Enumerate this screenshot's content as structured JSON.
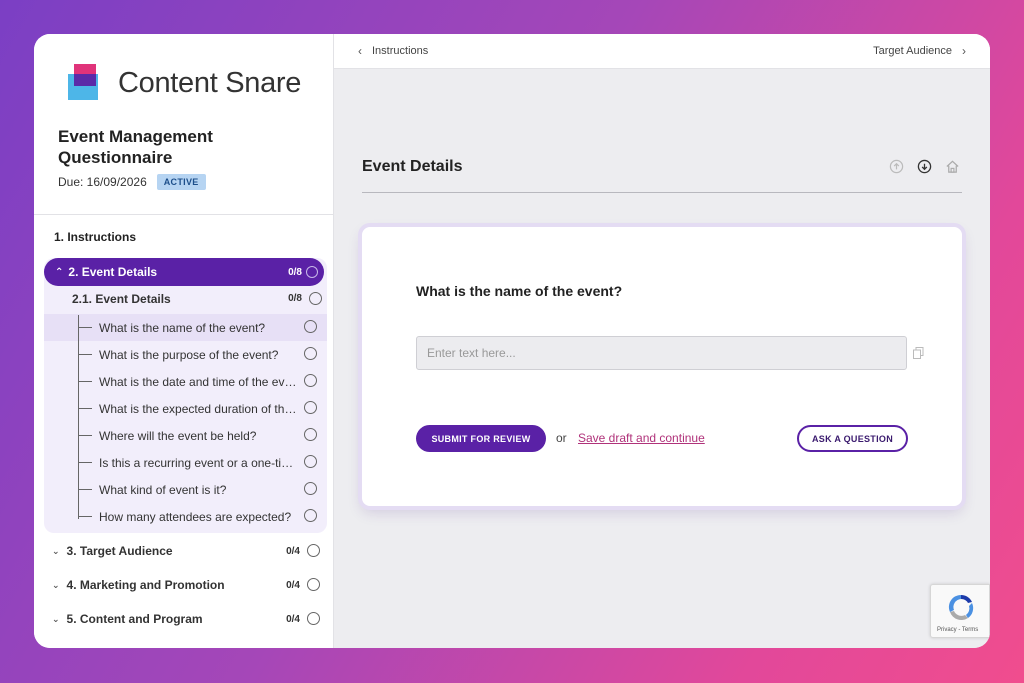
{
  "brand": {
    "name": "Content Snare"
  },
  "questionnaire": {
    "title": "Event Management Questionnaire",
    "due": "Due: 16/09/2026",
    "status": "ACTIVE"
  },
  "nav": {
    "section1": "1. Instructions",
    "active_section": {
      "label": "2. Event Details",
      "count": "0/8"
    },
    "subsection": {
      "label": "2.1. Event Details",
      "count": "0/8"
    },
    "questions": [
      "What is the name of the event?",
      "What is the purpose of the event?",
      "What is the date and time of the event?",
      "What is the expected duration of the event?",
      "Where will the event be held?",
      "Is this a recurring event or a one-time event?",
      "What kind of event is it?",
      "How many attendees are expected?"
    ],
    "sections": [
      {
        "label": "3. Target Audience",
        "count": "0/4"
      },
      {
        "label": "4. Marketing and Promotion",
        "count": "0/4"
      },
      {
        "label": "5. Content and Program",
        "count": "0/4"
      }
    ]
  },
  "topbar": {
    "prev_label": "Instructions",
    "next_label": "Target Audience"
  },
  "main": {
    "section_title": "Event Details",
    "question": "What is the name of the event?",
    "input_placeholder": "Enter text here...",
    "submit_label": "SUBMIT FOR REVIEW",
    "or_label": "or",
    "save_label": "Save draft and continue",
    "ask_label": "ASK A QUESTION"
  },
  "recaptcha": {
    "label": "Privacy - Terms"
  },
  "colors": {
    "primary": "#5a21a6",
    "link": "#b0327a",
    "badge_bg": "#b6d4f2"
  }
}
